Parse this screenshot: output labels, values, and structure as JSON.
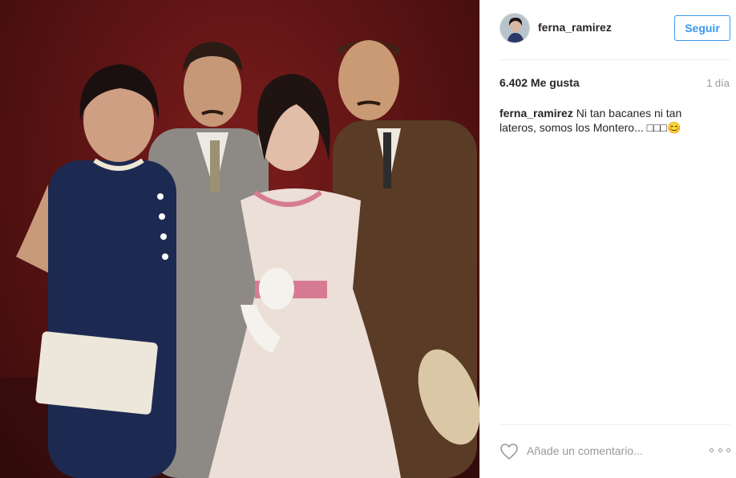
{
  "post": {
    "username": "ferna_ramirez",
    "follow_label": "Seguir",
    "likes": "6.402 Me gusta",
    "time_ago": "1 día",
    "caption_user": "ferna_ramirez",
    "caption_text": "Ni tan bacanes ni tan lateros, somos los Montero... □□□😊",
    "comment_placeholder": "Añade un comentario...",
    "accent_color": "#3897f0"
  },
  "icons": {
    "like": "heart-outline-icon",
    "options": "more-options-icon"
  }
}
